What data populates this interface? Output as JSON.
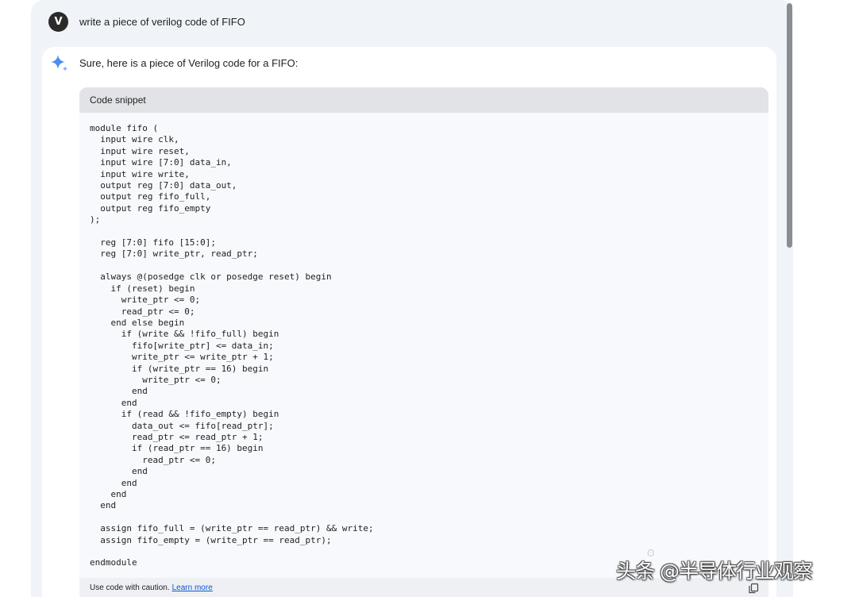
{
  "user": {
    "avatar_letter": "V",
    "prompt": "write a piece of verilog code of FIFO"
  },
  "response": {
    "intro": "Sure, here is a piece of Verilog code for a FIFO:",
    "code_block": {
      "header": "Code snippet",
      "code": "module fifo (\n  input wire clk,\n  input wire reset,\n  input wire [7:0] data_in,\n  input wire write,\n  output reg [7:0] data_out,\n  output reg fifo_full,\n  output reg fifo_empty\n);\n\n  reg [7:0] fifo [15:0];\n  reg [7:0] write_ptr, read_ptr;\n\n  always @(posedge clk or posedge reset) begin\n    if (reset) begin\n      write_ptr <= 0;\n      read_ptr <= 0;\n    end else begin\n      if (write && !fifo_full) begin\n        fifo[write_ptr] <= data_in;\n        write_ptr <= write_ptr + 1;\n        if (write_ptr == 16) begin\n          write_ptr <= 0;\n        end\n      end\n      if (read && !fifo_empty) begin\n        data_out <= fifo[read_ptr];\n        read_ptr <= read_ptr + 1;\n        if (read_ptr == 16) begin\n          read_ptr <= 0;\n        end\n      end\n    end\n  end\n\n  assign fifo_full = (write_ptr == read_ptr) && write;\n  assign fifo_empty = (write_ptr == read_ptr);\n\nendmodule",
      "caution_text": "Use code with caution.",
      "learn_more_label": "Learn more"
    }
  },
  "watermark": {
    "text": "头条 @半导体行业观察"
  },
  "colors": {
    "panel_bg": "#f0f4f9",
    "code_header_bg": "#e1e3e6",
    "link": "#0b57d0",
    "spark_blue": "#4285f4"
  },
  "icons": {
    "assistant": "sparkle-icon",
    "copy": "copy-icon"
  }
}
